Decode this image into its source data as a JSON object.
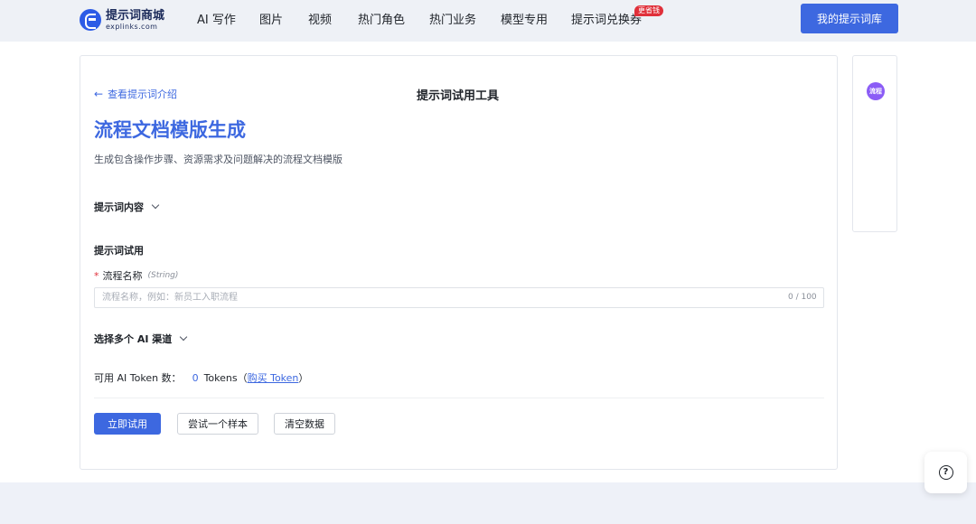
{
  "header": {
    "logo_cn": "提示词商城",
    "logo_en": "explinks.com",
    "nav": [
      "AI 写作",
      "图片",
      "视频",
      "热门角色",
      "热门业务",
      "模型专用",
      "提示词兑换券"
    ],
    "badge": "更省钱",
    "my_button": "我的提示词库"
  },
  "card": {
    "back_link": "查看提示词介绍",
    "tool_title": "提示词试用工具",
    "page_title": "流程文档模版生成",
    "page_desc": "生成包含操作步骤、资源需求及问题解决的流程文档模版",
    "prompt_content_label": "提示词内容",
    "trial_label": "提示词试用",
    "field": {
      "required_mark": "*",
      "label": "流程名称",
      "type": "(String)",
      "placeholder": "流程名称，例如：新员工入职流程",
      "value": "",
      "counter": "0 / 100"
    },
    "channels_label": "选择多个 AI 渠道",
    "token": {
      "prefix": "可用 AI Token 数：",
      "count": "0",
      "unit": "Tokens（",
      "buy": "购买 Token",
      "suffix": "）"
    },
    "buttons": {
      "try_now": "立即试用",
      "try_sample": "尝试一个样本",
      "clear": "清空数据"
    }
  },
  "side": {
    "avatar": "流程"
  },
  "colors": {
    "accent": "#3d68e0",
    "badge": "#e0303a",
    "avatar": "#8b5cf6"
  }
}
